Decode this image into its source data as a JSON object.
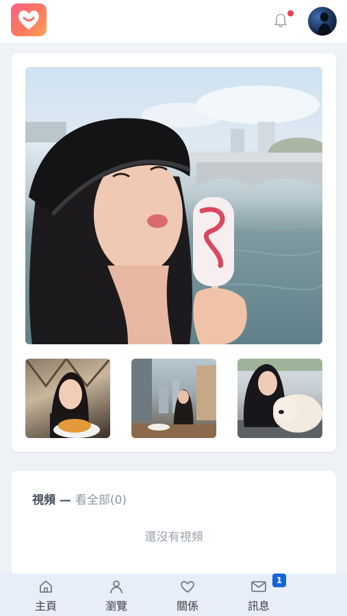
{
  "header": {
    "logo_icon": "heart-smile-icon",
    "notification_icon": "bell-icon",
    "notification_dot_color": "#ef3b55",
    "brand_colors": [
      "#ff5f86",
      "#ffa15a"
    ]
  },
  "gallery": {
    "main_photo": "main-profile-photo",
    "thumbnails": [
      "restaurant-photo",
      "cafe-window-photo",
      "dog-photo"
    ]
  },
  "videos": {
    "title": "視頻",
    "dash": " — ",
    "view_all": "看全部",
    "count": "(0)",
    "empty_text": "還沒有視頻"
  },
  "bottom_nav": {
    "items": [
      {
        "label": "主頁",
        "icon": "home-icon"
      },
      {
        "label": "瀏覽",
        "icon": "person-icon"
      },
      {
        "label": "關係",
        "icon": "heart-icon"
      },
      {
        "label": "訊息",
        "icon": "mail-icon"
      }
    ],
    "badge": "1",
    "badge_color": "#1565d8"
  }
}
